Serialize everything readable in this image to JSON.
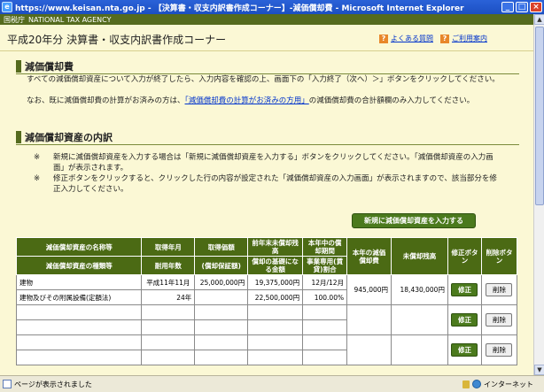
{
  "window": {
    "title": "https://www.keisan.nta.go.jp - 【決算書・収支内訳書作成コーナー】-減価償却費 - Microsoft Internet Explorer",
    "icon_name": "ie-icon",
    "controls": [
      "minimize",
      "maximize",
      "close"
    ]
  },
  "agency": {
    "name_ja": "国税庁",
    "name_en": "NATIONAL TAX AGENCY"
  },
  "header": {
    "title": "平成20年分 決算書・収支内訳書作成コーナー",
    "links": [
      {
        "icon": "?",
        "label": "よくある質問"
      },
      {
        "icon": "?",
        "label": "ご利用案内"
      }
    ]
  },
  "section1": {
    "heading": "減価償却費",
    "line1": "すべての減価償却資産について入力が終了したら、入力内容を確認の上、画面下の「入力終了（次へ）＞」ボタンをクリックしてください。",
    "line2_prefix": "なお、既に減価償却費の計算がお済みの方は、",
    "line2_link": "「減価償却費の計算がお済みの方用」",
    "line2_suffix": "の減価償却費の合計額欄のみ入力してください。"
  },
  "section2": {
    "heading": "減価償却資産の内訳",
    "note1_mark": "※",
    "note1": "新規に減価償却資産を入力する場合は「新規に減価償却資産を入力する」ボタンをクリックしてください。「減価償却資産の入力画面」が表示されます。",
    "note2_mark": "※",
    "note2": "修正ボタンをクリックすると、クリックした行の内容が設定された「減価償却資産の入力画面」が表示されますので、該当部分を修正入力してください。",
    "new_button": "新規に減価償却資産を入力する"
  },
  "table": {
    "header_row1": [
      "減価償却資産の名称等",
      "取得年月",
      "取得価額",
      "前年末未償却残高",
      "本年中の償却期間",
      "本年の減価償却費",
      "未償却残高",
      "修正ボタン",
      "削除ボタン"
    ],
    "header_row2": [
      "減価償却資産の種類等",
      "耐用年数",
      "(償却保証額)",
      "償却の基礎になる金額",
      "事業専用(賃貸)割合"
    ],
    "fix_label": "修正",
    "del_label": "削除",
    "rows": [
      {
        "name": "建物",
        "acq": "平成11年11月",
        "price": "25,000,000円",
        "prev": "19,375,000円",
        "period": "12月/12月",
        "dep": "945,000円",
        "remain": "18,430,000円",
        "kind": "建物及びその附属設備(定額法)",
        "life": "24年",
        "guarantee": "",
        "base": "22,500,000円",
        "ratio": "100.00%"
      },
      {
        "name": "",
        "acq": "",
        "price": "",
        "prev": "",
        "period": "",
        "dep": "",
        "remain": "",
        "kind": "",
        "life": "",
        "guarantee": "",
        "base": "",
        "ratio": ""
      },
      {
        "name": "",
        "acq": "",
        "price": "",
        "prev": "",
        "period": "",
        "dep": "",
        "remain": "",
        "kind": "",
        "life": "",
        "guarantee": "",
        "base": "",
        "ratio": ""
      }
    ]
  },
  "status": {
    "message": "ページが表示されました",
    "zone": "インターネット"
  },
  "colors": {
    "header_green": "#4b6a14",
    "button_green": "#4b7a1d",
    "background": "#fbf8d5",
    "link_blue": "#0033cc"
  }
}
